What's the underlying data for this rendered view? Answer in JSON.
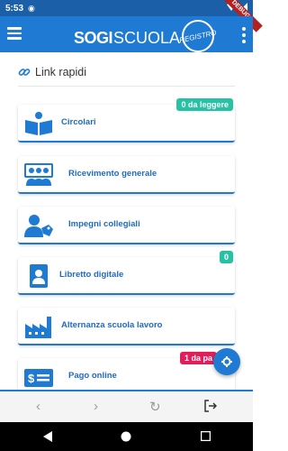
{
  "status_bar": {
    "time": "5:53",
    "debug_label": "DEBUG"
  },
  "app_bar": {
    "logo_bold": "SOGI",
    "logo_light": "SCUOLA",
    "logo_badge": "REGISTRO"
  },
  "section": {
    "title": "Link rapidi"
  },
  "cards": [
    {
      "label": "Circolari",
      "badge": "0 da leggere",
      "icon": "book-icon",
      "badge_color": "#27c2a4"
    },
    {
      "label": "Ricevimento generale",
      "badge": "",
      "icon": "meeting-icon"
    },
    {
      "label": "Impegni collegiali",
      "badge": "",
      "icon": "person-tag-icon"
    },
    {
      "label": "Libretto digitale",
      "badge": "0",
      "icon": "id-booklet-icon",
      "badge_color": "#27c2a4"
    },
    {
      "label": "Alternanza scuola lavoro",
      "badge": "",
      "icon": "factory-icon"
    },
    {
      "label": "Pago online",
      "badge": "1 da pa",
      "icon": "money-icon",
      "badge_color": "#e11d5b"
    }
  ],
  "fab": {
    "icon": "gear-icon"
  },
  "browser": {
    "back": "‹",
    "forward": "›",
    "reload": "↻"
  },
  "colors": {
    "primary": "#1f7ad3",
    "accent_teal": "#27c2a4",
    "accent_pink": "#e11d5b"
  }
}
